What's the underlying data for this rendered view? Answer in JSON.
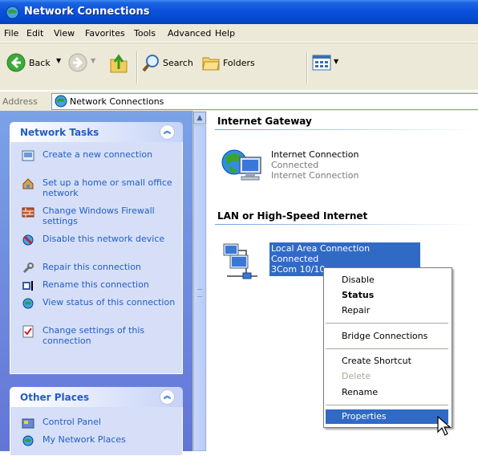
{
  "window": {
    "title": "Network Connections"
  },
  "menubar": {
    "items": [
      "File",
      "Edit",
      "View",
      "Favorites",
      "Tools",
      "Advanced",
      "Help"
    ]
  },
  "toolbar": {
    "back_label": "Back",
    "search_label": "Search",
    "folders_label": "Folders"
  },
  "address": {
    "label": "Address",
    "value": "Network Connections"
  },
  "network_tasks": {
    "title": "Network Tasks",
    "items": [
      {
        "label": "Create a new connection",
        "icon": "new-connection-icon"
      },
      {
        "label": "Set up a home or small office network",
        "icon": "home-network-icon"
      },
      {
        "label": "Change Windows Firewall settings",
        "icon": "firewall-icon"
      },
      {
        "label": "Disable this network device",
        "icon": "disable-icon"
      },
      {
        "label": "Repair this connection",
        "icon": "repair-icon"
      },
      {
        "label": "Rename this connection",
        "icon": "rename-icon"
      },
      {
        "label": "View status of this connection",
        "icon": "status-icon"
      },
      {
        "label": "Change settings of this connection",
        "icon": "settings-icon"
      }
    ]
  },
  "other_places": {
    "title": "Other Places",
    "items": [
      {
        "label": "Control Panel",
        "icon": "control-panel-icon"
      },
      {
        "label": "My Network Places",
        "icon": "network-places-icon"
      }
    ]
  },
  "groups": {
    "gateway": "Internet Gateway",
    "lan": "LAN or High-Speed Internet"
  },
  "connections": {
    "internet": {
      "name": "Internet Connection",
      "status": "Connected",
      "type": "Internet Connection"
    },
    "lan": {
      "name": "Local Area Connection",
      "status": "Connected",
      "device": "3Com 10/10"
    }
  },
  "context_menu": {
    "disable": "Disable",
    "status": "Status",
    "repair": "Repair",
    "bridge": "Bridge Connections",
    "shortcut": "Create Shortcut",
    "delete": "Delete",
    "rename": "Rename",
    "properties": "Properties"
  },
  "colors": {
    "title_bar": "#0a52dc",
    "task_link": "#215dc6",
    "selection": "#316ac5",
    "menu_bar": "#ece9d8"
  }
}
